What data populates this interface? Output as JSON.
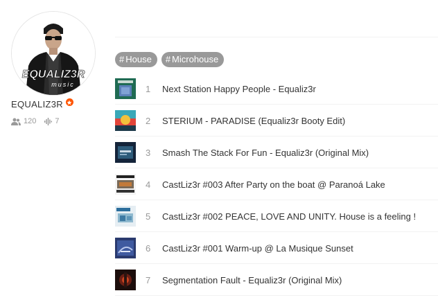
{
  "user": {
    "name": "EQUALIZ3R",
    "logo_text": "EQUALIZ3R",
    "logo_sub": "music",
    "followers": "120",
    "tracks": "7"
  },
  "tags": [
    {
      "label": "House"
    },
    {
      "label": "Microhouse"
    }
  ],
  "tracks": [
    {
      "num": "1",
      "title": "Next Station Happy People - Equaliz3r"
    },
    {
      "num": "2",
      "title": "STERIUM - PARADISE (Equaliz3r Booty Edit)"
    },
    {
      "num": "3",
      "title": "Smash The Stack For Fun - Equaliz3r (Original Mix)"
    },
    {
      "num": "4",
      "title": "CastLiz3r #003 After Party on the boat @ Paranoá Lake"
    },
    {
      "num": "5",
      "title": "CastLiz3r #002 PEACE, LOVE AND UNITY. House is a feeling !"
    },
    {
      "num": "6",
      "title": "CastLiz3r #001 Warm-up @ La Musique Sunset"
    },
    {
      "num": "7",
      "title": "Segmentation Fault - Equaliz3r (Original Mix)"
    }
  ],
  "colors": {
    "accent": "#ff5500",
    "tag_bg": "#999999",
    "text": "#333333",
    "muted": "#999999"
  }
}
